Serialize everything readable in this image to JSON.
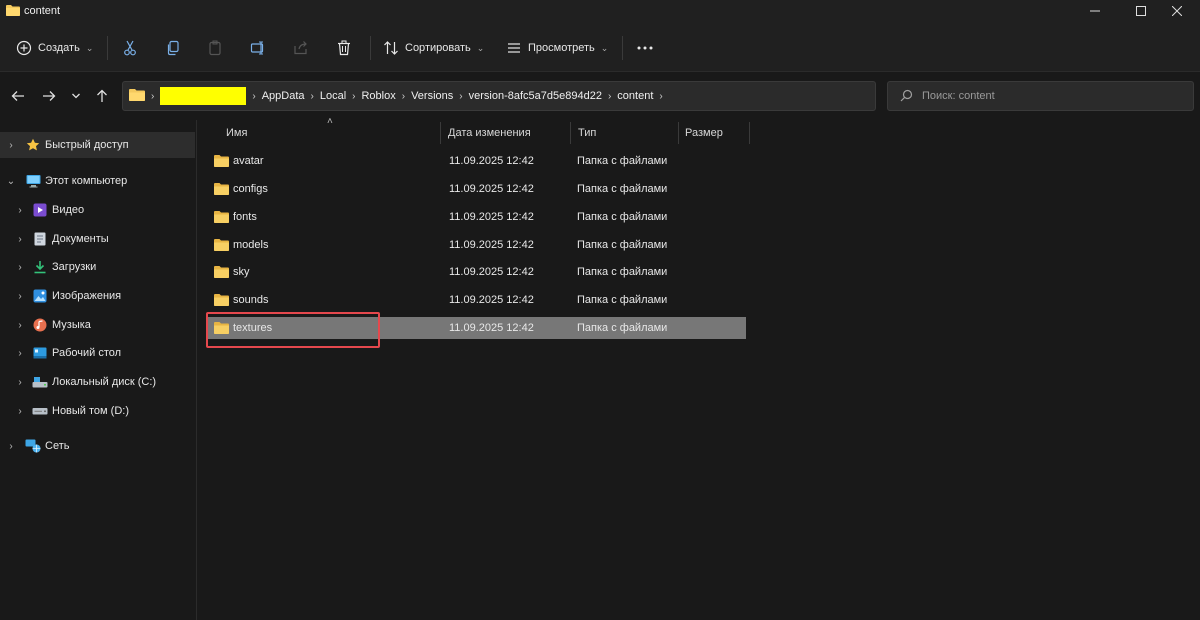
{
  "window": {
    "title": "content",
    "icons": {
      "folder": "folder-icon",
      "minimize": "minimize-icon",
      "maximize": "maximize-icon",
      "close": "close-icon"
    }
  },
  "toolbar": {
    "create_label": "Создать",
    "sort_label": "Сортировать",
    "view_label": "Просмотреть",
    "icons": [
      "new-icon",
      "cut-icon",
      "copy-icon",
      "paste-icon",
      "rename-icon",
      "share-icon",
      "delete-icon",
      "sort-icon",
      "view-icon",
      "more-icon"
    ]
  },
  "address": {
    "breadcrumbs": [
      "AppData",
      "Local",
      "Roblox",
      "Versions",
      "version-8afc5a7d5e894d22",
      "content"
    ],
    "redaction_color": "#ffff00"
  },
  "search": {
    "placeholder": "Поиск: content"
  },
  "sidebar": {
    "quick_access": "Быстрый доступ",
    "this_pc": "Этот компьютер",
    "items": [
      {
        "label": "Видео",
        "icon": "video-icon"
      },
      {
        "label": "Документы",
        "icon": "documents-icon"
      },
      {
        "label": "Загрузки",
        "icon": "downloads-icon"
      },
      {
        "label": "Изображения",
        "icon": "pictures-icon"
      },
      {
        "label": "Музыка",
        "icon": "music-icon"
      },
      {
        "label": "Рабочий стол",
        "icon": "desktop-icon"
      },
      {
        "label": "Локальный диск (C:)",
        "icon": "local-disk-icon"
      },
      {
        "label": "Новый том (D:)",
        "icon": "drive-icon"
      }
    ],
    "network": "Сеть"
  },
  "table": {
    "columns": [
      "Имя",
      "Дата изменения",
      "Тип",
      "Размер"
    ],
    "rows": [
      {
        "name": "avatar",
        "date": "11.09.2025 12:42",
        "type": "Папка с файлами",
        "selected": false
      },
      {
        "name": "configs",
        "date": "11.09.2025 12:42",
        "type": "Папка с файлами",
        "selected": false
      },
      {
        "name": "fonts",
        "date": "11.09.2025 12:42",
        "type": "Папка с файлами",
        "selected": false
      },
      {
        "name": "models",
        "date": "11.09.2025 12:42",
        "type": "Папка с файлами",
        "selected": false
      },
      {
        "name": "sky",
        "date": "11.09.2025 12:42",
        "type": "Папка с файлами",
        "selected": false
      },
      {
        "name": "sounds",
        "date": "11.09.2025 12:42",
        "type": "Папка с файлами",
        "selected": false
      },
      {
        "name": "textures",
        "date": "11.09.2025 12:42",
        "type": "Папка с файлами",
        "selected": true
      }
    ]
  },
  "colors": {
    "background": "#191919",
    "selected_row": "#777777",
    "highlight_border": "#e5484d",
    "folder": "#f4c95d"
  }
}
